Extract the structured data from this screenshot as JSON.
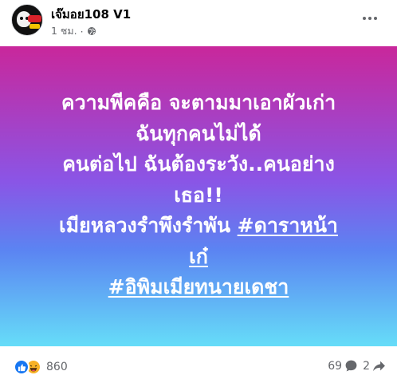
{
  "post": {
    "author": "เจ๊มอย108 V1",
    "time": "1 ชม.",
    "separator": "·",
    "privacy_icon": "globe-icon",
    "menu_icon": "more-options-icon",
    "lines": {
      "l1": "ความพีคคือ จะตามมาเอาผัวเก่า",
      "l2": "ฉันทุกคนไม่ได้",
      "l3": "คนต่อไป ฉันต้องระวัง..คนอย่าง",
      "l4": "เธอ!!",
      "l5_text": "เมียหลวงรำพึงรำพัน ",
      "l5_tag": "#ดาราหน้า",
      "l6_tag": "เก๋",
      "l7_tag": "#อิพิมเมียทนายเดชา"
    },
    "background": {
      "top": "#c9279b",
      "middle": "#8a55e6",
      "bottom": "#66ddf8"
    }
  },
  "footer": {
    "reaction_icons": [
      "like-icon",
      "haha-icon"
    ],
    "reaction_count": "860",
    "comment_count": "69",
    "comment_icon": "comment-icon",
    "share_count": "2",
    "share_icon": "share-icon"
  }
}
